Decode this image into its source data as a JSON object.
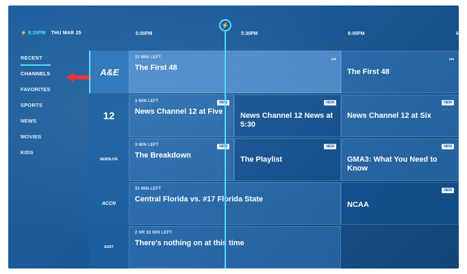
{
  "header": {
    "clock": "5:26PM",
    "date": "THU MAR 25",
    "slots": [
      "5:00PM",
      "5:30PM",
      "6:00PM",
      "6"
    ]
  },
  "nav": {
    "items": [
      {
        "label": "RECENT"
      },
      {
        "label": "CHANNELS"
      },
      {
        "label": "FAVORITES"
      },
      {
        "label": "SPORTS"
      },
      {
        "label": "NEWS"
      },
      {
        "label": "MOVIES"
      },
      {
        "label": "KIDS"
      }
    ],
    "active": "CHANNELS"
  },
  "rows": [
    {
      "channel": "A&E",
      "programs": [
        {
          "time_left": "33 MIN LEFT",
          "title": "The First 48"
        },
        {
          "title": "The First 48"
        }
      ]
    },
    {
      "channel": "12",
      "programs": [
        {
          "time_left": "3 MIN LEFT",
          "title": "News Channel 12 at Five",
          "badge": "NEW"
        },
        {
          "title": "News Channel 12 News at 5:30",
          "badge": "NEW"
        },
        {
          "title": "News Channel 12 at Six",
          "badge": "NEW"
        }
      ]
    },
    {
      "channel": "NEWSLIVE",
      "programs": [
        {
          "time_left": "3 MIN LEFT",
          "title": "The Breakdown",
          "badge": "NEW"
        },
        {
          "title": "The Playlist",
          "badge": "NEW"
        },
        {
          "title": "GMA3: What You Need to Know",
          "badge": "NEW"
        }
      ]
    },
    {
      "channel": "ACCN",
      "programs": [
        {
          "time_left": "33 MIN LEFT",
          "title": "Central Florida vs. #17 Florida State"
        },
        {
          "title": "NCAA",
          "badge": "NEW"
        }
      ]
    },
    {
      "channel": "EAST",
      "programs": [
        {
          "time_left": "2 HR 33 MIN LEFT",
          "title": "There's nothing on at this time"
        }
      ]
    }
  ],
  "colors": {
    "accent": "#4fe0ff",
    "background": "#1d5f9e"
  }
}
